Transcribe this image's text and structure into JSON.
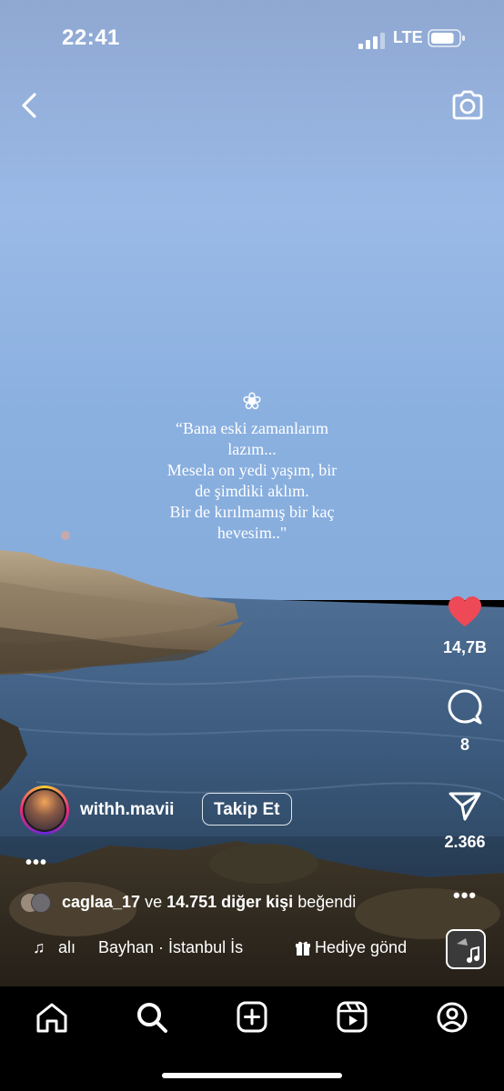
{
  "status_bar": {
    "time": "22:41",
    "network": "LTE",
    "battery_level": 0.85
  },
  "top_bar": {
    "back_icon": "chevron-left-icon",
    "camera_icon": "camera-icon"
  },
  "overlay": {
    "flower_glyph": "❀",
    "quote": "“Bana eski zamanlarım\nlazım...\nMesela on yedi yaşım, bir\nde şimdiki aklım.\nBir de kırılmamış bir kaç\nhevesim..\""
  },
  "actions": {
    "like_count": "14,7B",
    "comment_count": "8",
    "share_count": "2.366",
    "like_color": "#ED4956",
    "more": "•••"
  },
  "author": {
    "username": "withh.mavii",
    "follow_label": "Takip Et"
  },
  "caption": {
    "more": "•••"
  },
  "likes": {
    "user": "caglaa_17",
    "connector": " ve ",
    "others": "14.751 diğer kişi",
    "suffix": " beğendi"
  },
  "music": {
    "note_icon": "♫",
    "artist_tail": "alı",
    "track": "Bayhan · İstanbul İs",
    "gift_icon": "gift-icon",
    "gift_label": "Hediye gönd"
  },
  "tab_bar": {
    "items": [
      "home-icon",
      "search-icon",
      "create-icon",
      "reels-icon",
      "profile-icon"
    ]
  }
}
